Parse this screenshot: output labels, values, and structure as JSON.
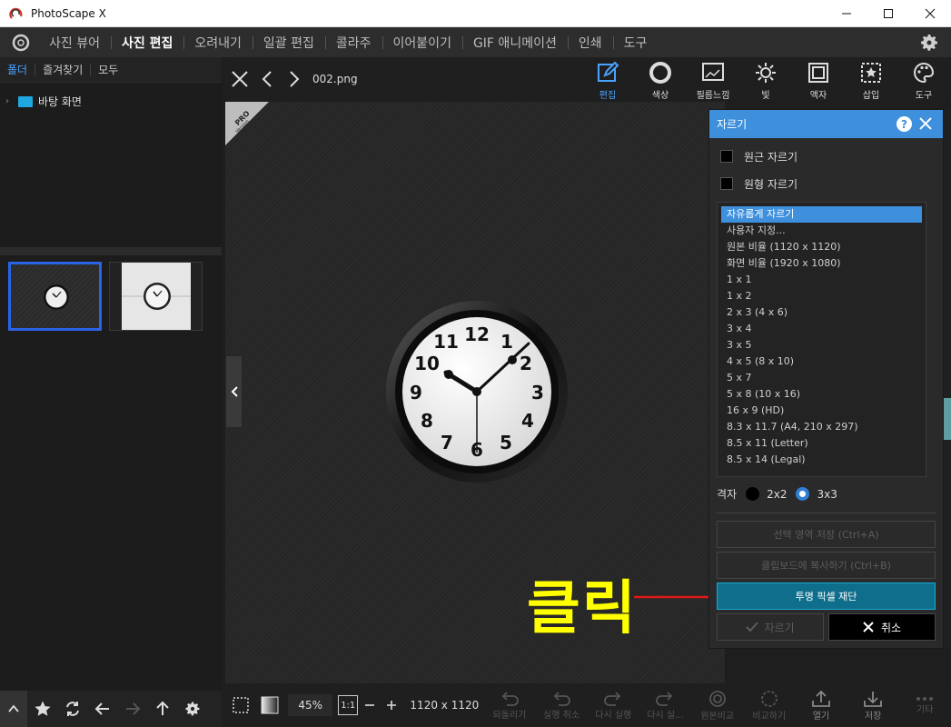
{
  "window": {
    "title": "PhotoScape X"
  },
  "menu": {
    "items": [
      {
        "label": "사진 뷰어"
      },
      {
        "label": "사진 편집"
      },
      {
        "label": "오려내기"
      },
      {
        "label": "일괄 편집"
      },
      {
        "label": "콜라주"
      },
      {
        "label": "이어붙이기"
      },
      {
        "label": "GIF 애니메이션"
      },
      {
        "label": "인쇄"
      },
      {
        "label": "도구"
      }
    ]
  },
  "left": {
    "tabs": [
      "폴더",
      "즐겨찾기",
      "모두"
    ],
    "tree": {
      "label": "바탕 화면"
    }
  },
  "viewer": {
    "filename": "002.png",
    "badge": "PRO Version"
  },
  "toolbar": {
    "items": [
      "편집",
      "색상",
      "필름느낌",
      "빛",
      "액자",
      "삽입",
      "도구"
    ]
  },
  "crop": {
    "title": "자르기",
    "help": "?",
    "checks": [
      "원근 자르기",
      "원형 자르기"
    ],
    "options": [
      "자유롭게 자르기",
      "사용자 지정...",
      "원본 비율 (1120 x 1120)",
      "화면 비율 (1920 x 1080)",
      "1 x 1",
      "1 x 2",
      "2 x 3 (4 x 6)",
      "3 x 4",
      "3 x 5",
      "4 x 5 (8 x 10)",
      "5 x 7",
      "5 x 8 (10 x 16)",
      "16 x 9 (HD)",
      "8.3 x 11.7 (A4, 210 x 297)",
      "8.5 x 11 (Letter)",
      "8.5 x 14 (Legal)"
    ],
    "grid_label": "격자",
    "grid_2": "2x2",
    "grid_3": "3x3",
    "save_selection": "선택 영역 저장 (Ctrl+A)",
    "copy_clipboard": "클립보드에 복사하기 (Ctrl+B)",
    "trim_transparent": "투명 픽셀 재단",
    "ok": "자르기",
    "cancel": "취소"
  },
  "annotation": {
    "text": "클릭",
    "color": "#ffff00"
  },
  "bottom": {
    "zoom": "45%",
    "one_to_one": "1:1",
    "size": "1120 x 1120",
    "tools": [
      "되돌리기",
      "실행 취소",
      "다시 실행",
      "다시 실...",
      "원본비교",
      "비교하기",
      "열기",
      "저장",
      "기타"
    ]
  },
  "colors": {
    "accent": "#3e8fdc",
    "primary_button": "#0f6e8c",
    "selection_border": "#2a63e6"
  }
}
